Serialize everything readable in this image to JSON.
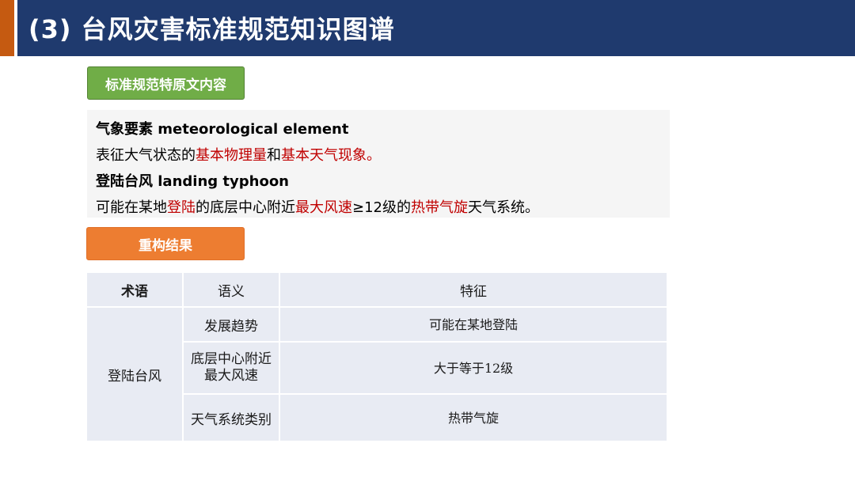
{
  "header": {
    "title": "(3) 台风灾害标准规范知识图谱"
  },
  "colors": {
    "header_bg": "#1f3a6e",
    "accent": "#c55a11",
    "green": "#70ad47",
    "orange": "#ed7d31",
    "red": "#c00000"
  },
  "section_labels": {
    "original": "标准规范特原文内容",
    "result": "重构结果"
  },
  "excerpt": {
    "line1": "气象要素 meteorological element",
    "line2": {
      "a": "表征大气状态的",
      "b": "基本物理量",
      "c": "和",
      "d": "基本天气现象",
      "e": "。"
    },
    "line3": "登陆台风  landing typhoon",
    "line4": {
      "a": "可能在某地",
      "b": "登陆",
      "c": "的底层中心附近",
      "d": "最大风速",
      "e": "≥12级的",
      "f": "热带气旋",
      "g": "天气系统。"
    }
  },
  "table": {
    "headers": [
      "术语",
      "语义",
      "特征"
    ],
    "term": "登陆台风",
    "rows": [
      {
        "semantic": "发展趋势",
        "feature": "可能在某地登陆"
      },
      {
        "semantic": "底层中心附近\n最大风速",
        "feature": "大于等于12级"
      },
      {
        "semantic": "天气系统类别",
        "feature": "热带气旋"
      }
    ]
  }
}
